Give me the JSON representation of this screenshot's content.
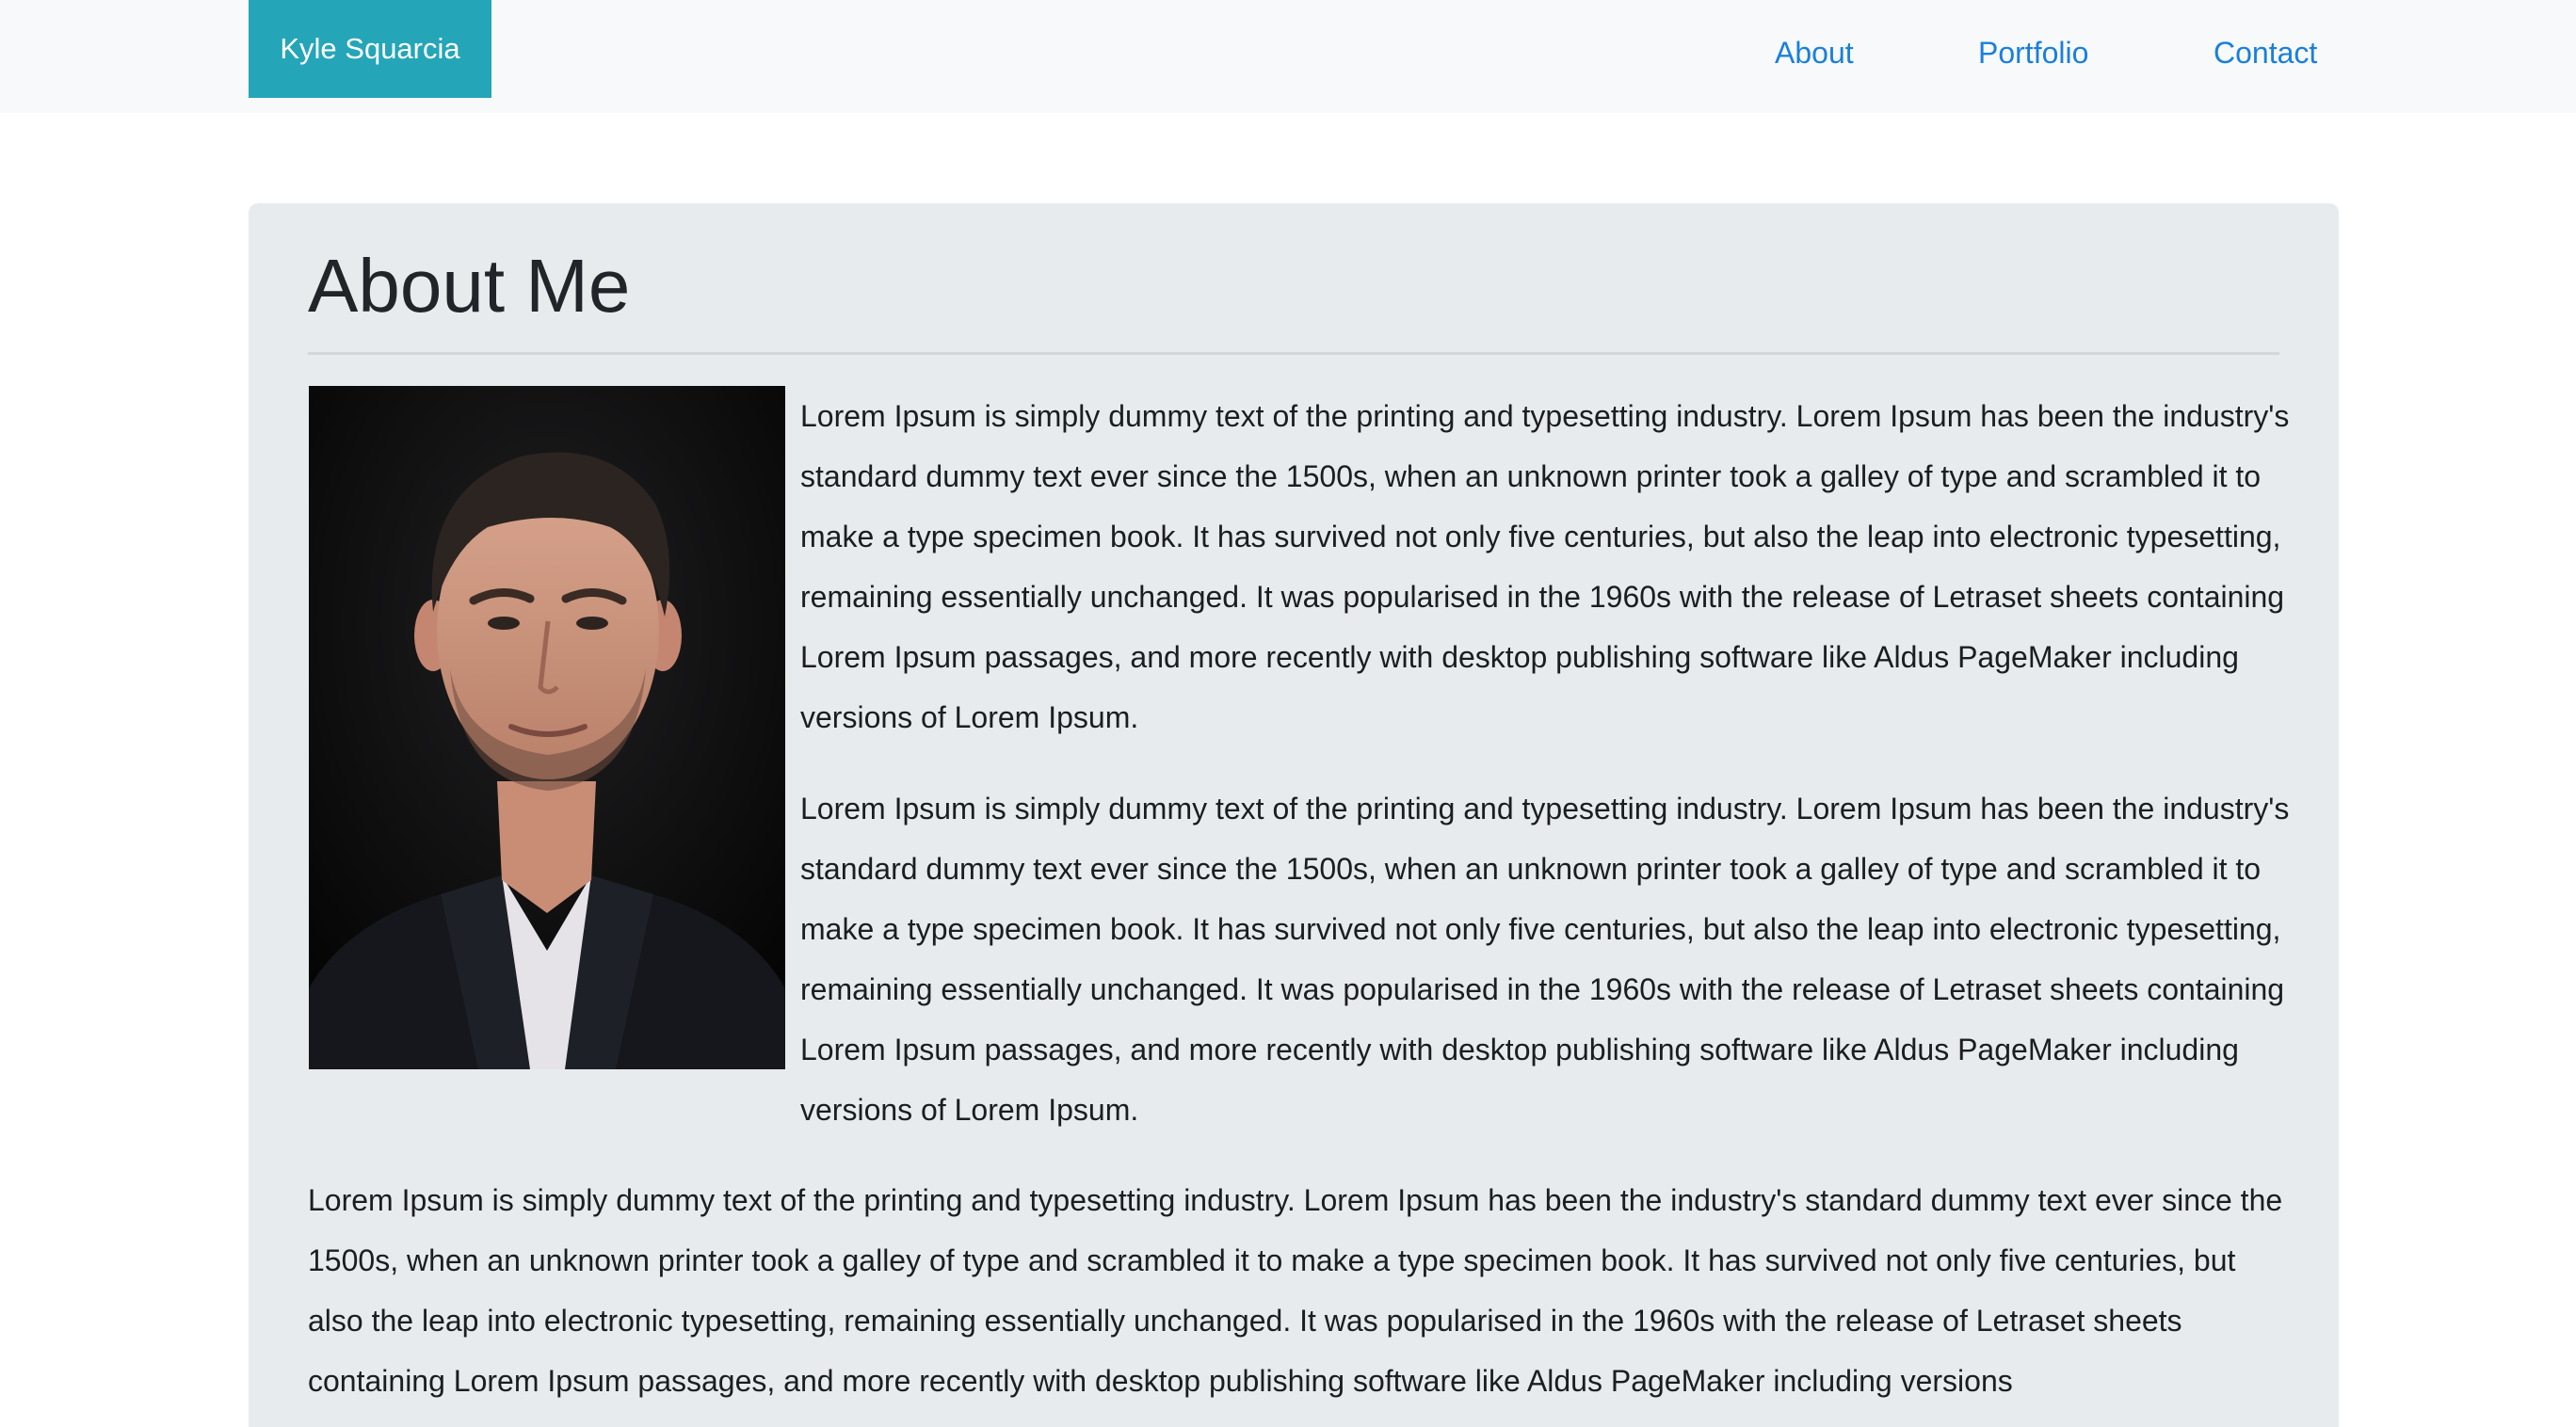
{
  "navbar": {
    "brand": "Kyle Squarcia",
    "links": [
      "About",
      "Portfolio",
      "Contact"
    ]
  },
  "main": {
    "title": "About Me",
    "paragraphs": [
      "Lorem Ipsum is simply dummy text of the printing and typesetting industry. Lorem Ipsum has been the industry's standard dummy text ever since the 1500s, when an unknown printer took a galley of type and scrambled it to make a type specimen book. It has survived not only five centuries, but also the leap into electronic typesetting, remaining essentially unchanged. It was popularised in the 1960s with the release of Letraset sheets containing Lorem Ipsum passages, and more recently with desktop publishing software like Aldus PageMaker including versions of Lorem Ipsum.",
      "Lorem Ipsum is simply dummy text of the printing and typesetting industry. Lorem Ipsum has been the industry's standard dummy text ever since the 1500s, when an unknown printer took a galley of type and scrambled it to make a type specimen book. It has survived not only five centuries, but also the leap into electronic typesetting, remaining essentially unchanged. It was popularised in the 1960s with the release of Letraset sheets containing Lorem Ipsum passages, and more recently with desktop publishing software like Aldus PageMaker including versions of Lorem Ipsum.",
      "Lorem Ipsum is simply dummy text of the printing and typesetting industry. Lorem Ipsum has been the industry's standard dummy text ever since the 1500s, when an unknown printer took a galley of type and scrambled it to make a type specimen book. It has survived not only five centuries, but also the leap into electronic typesetting, remaining essentially unchanged. It was popularised in the 1960s with the release of Letraset sheets containing Lorem Ipsum passages, and more recently with desktop publishing software like Aldus PageMaker including versions"
    ]
  },
  "colors": {
    "navbar_bg": "#f8f9fa",
    "brand_bg": "#25a5b8",
    "link": "#1a7fdc",
    "jumbotron_bg": "#e8ebee",
    "text": "#212529"
  }
}
